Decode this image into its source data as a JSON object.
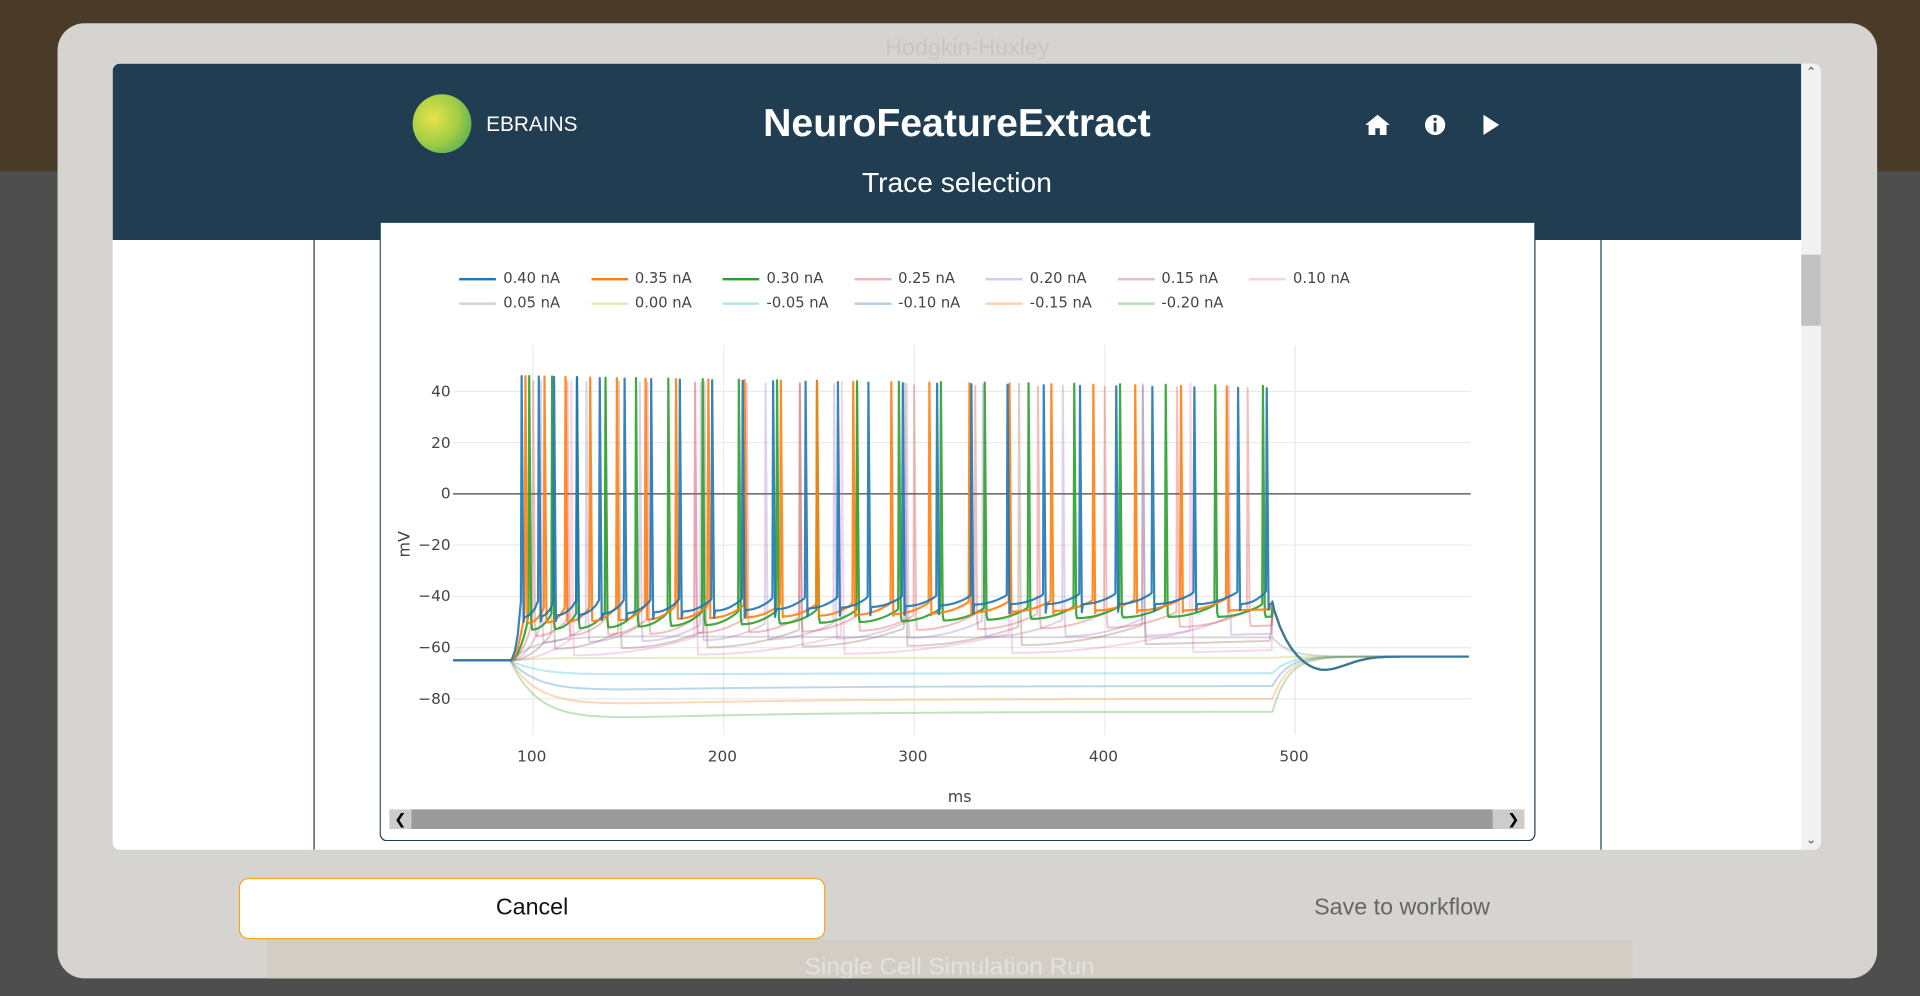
{
  "background": {
    "app_title": "Hodgkin-Huxley",
    "run_button": "Single Cell Simulation Run"
  },
  "header": {
    "brand": "EBRAINS",
    "title": "NeuroFeatureExtract",
    "subtitle": "Trace selection",
    "icons": [
      "home-icon",
      "info-icon",
      "play-icon"
    ]
  },
  "footer": {
    "cancel_label": "Cancel",
    "save_label": "Save to workflow"
  },
  "colors": {
    "header_bg": "#213d52",
    "cancel_border": "#f5a623"
  },
  "chart_data": {
    "type": "line",
    "xlabel": "ms",
    "ylabel": "mV",
    "xlim": [
      58,
      592
    ],
    "ylim": [
      -94,
      58
    ],
    "xticks": [
      100,
      200,
      300,
      400,
      500
    ],
    "yticks": [
      40,
      20,
      0,
      -20,
      -40,
      -60,
      -80
    ],
    "legend_placement": "top",
    "stimulus": {
      "start_ms": 88,
      "end_ms": 488,
      "resting_mV": -65
    },
    "series": [
      {
        "name": "0.40 nA",
        "color": "#1f77b4",
        "opacity": 1,
        "spike_times": [
          94,
          103,
          111,
          123,
          135,
          148,
          162,
          177,
          194,
          210,
          226,
          243,
          260,
          276,
          294,
          312,
          330,
          349,
          368,
          387,
          406,
          425,
          447,
          470,
          485
        ]
      },
      {
        "name": "0.35 nA",
        "color": "#ff7f0e",
        "opacity": 1,
        "spike_times": [
          96,
          106,
          117,
          130,
          144,
          159,
          175,
          192,
          211,
          230,
          249,
          268,
          288,
          308,
          329,
          350,
          372,
          394,
          416,
          440,
          464
        ]
      },
      {
        "name": "0.30 nA",
        "color": "#2ca02c",
        "opacity": 1,
        "spike_times": [
          98,
          110,
          123,
          138,
          154,
          171,
          189,
          208,
          228,
          249,
          270,
          292,
          314,
          337,
          360,
          384,
          408,
          432,
          458,
          483
        ]
      },
      {
        "name": "0.25 nA",
        "color": "#d62728",
        "opacity": 0.2,
        "spike_times": [
          100,
          118,
          138,
          160,
          185,
          212,
          240,
          270,
          300,
          332,
          365,
          400,
          438,
          475
        ]
      },
      {
        "name": "0.20 nA",
        "color": "#9467bd",
        "opacity": 0.2,
        "spike_times": [
          104,
          128,
          156,
          188,
          222,
          258,
          296,
          336,
          378,
          420,
          465
        ]
      },
      {
        "name": "0.15 nA",
        "color": "#8c564b",
        "opacity": 0.2,
        "spike_times": [
          110,
          145,
          190,
          240,
          295,
          355,
          420
        ]
      },
      {
        "name": "0.10 nA",
        "color": "#e377c2",
        "opacity": 0.2,
        "spike_times": [
          120,
          185,
          262,
          350,
          445
        ]
      },
      {
        "name": "0.05 nA",
        "color": "#7f7f7f",
        "opacity": 0.2,
        "steady_mV": -56,
        "peak_mV": -55
      },
      {
        "name": "0.00 nA",
        "color": "#bcbd22",
        "opacity": 0.2,
        "steady_mV": -64,
        "peak_mV": -64
      },
      {
        "name": "-0.05 nA",
        "color": "#17becf",
        "opacity": 0.2,
        "steady_mV": -70,
        "peak_mV": -71
      },
      {
        "name": "-0.10 nA",
        "color": "#1f77b4",
        "opacity": 0.2,
        "steady_mV": -75,
        "peak_mV": -78
      },
      {
        "name": "-0.15 nA",
        "color": "#ff7f0e",
        "opacity": 0.2,
        "steady_mV": -80,
        "peak_mV": -84
      },
      {
        "name": "-0.20 nA",
        "color": "#2ca02c",
        "opacity": 0.2,
        "steady_mV": -85,
        "peak_mV": -90
      }
    ]
  }
}
